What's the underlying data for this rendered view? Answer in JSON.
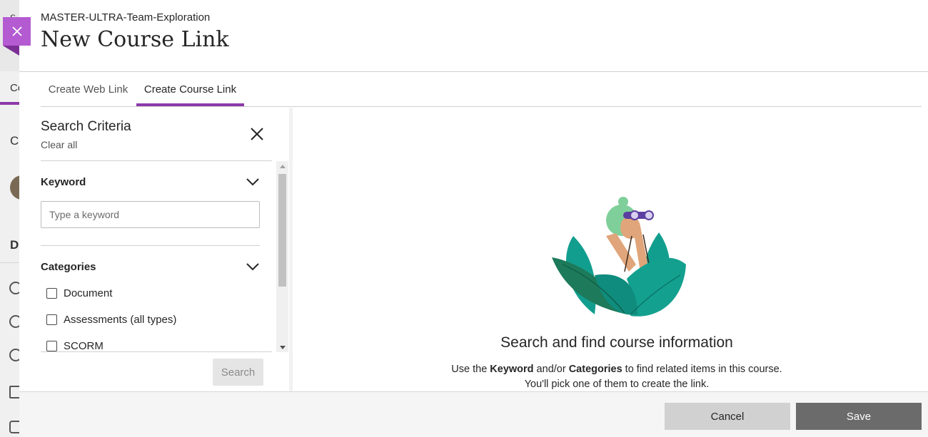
{
  "background_page": {
    "fragments": [
      "S",
      "Co",
      "C",
      "D"
    ]
  },
  "header": {
    "course_name": "MASTER-ULTRA-Team-Exploration",
    "title": "New Course Link"
  },
  "tabs": [
    {
      "label": "Create Web Link",
      "selected": false
    },
    {
      "label": "Create Course Link",
      "selected": true
    }
  ],
  "search_criteria": {
    "title": "Search Criteria",
    "clear_all": "Clear all",
    "keyword": {
      "label": "Keyword",
      "placeholder": "Type a keyword",
      "value": ""
    },
    "categories": {
      "label": "Categories",
      "items": [
        {
          "label": "Document",
          "checked": false
        },
        {
          "label": "Assessments (all types)",
          "checked": false
        },
        {
          "label": "SCORM",
          "checked": false
        }
      ]
    },
    "search_button": "Search"
  },
  "empty_state": {
    "title": "Search and find course information",
    "desc_prefix": "Use the ",
    "desc_keyword": "Keyword",
    "desc_middle": " and/or ",
    "desc_categories": "Categories",
    "desc_suffix": " to find related items in this course.",
    "desc_line2": "You'll pick one of them to create the link."
  },
  "footer": {
    "cancel": "Cancel",
    "save": "Save"
  },
  "colors": {
    "accent_purple": "#8c3aa8",
    "close_tab": "#b45bd2",
    "save_button": "#6b6b6b",
    "cancel_button": "#d1d1d1"
  }
}
